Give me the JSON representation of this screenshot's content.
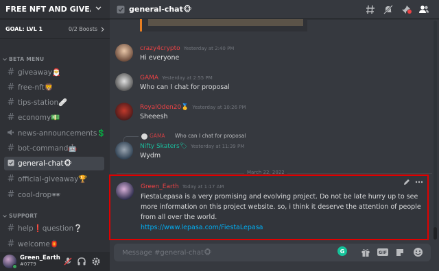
{
  "server": {
    "name": "FREE NFT AND GIVEAW..."
  },
  "boost": {
    "goal": "GOAL: LVL 1",
    "count": "0/2 Boosts"
  },
  "sidebar": {
    "category1": "BETA MENU",
    "category2": "SUPPORT",
    "channels": [
      {
        "label": "giveaway🎅"
      },
      {
        "label": "free-nft🦁"
      },
      {
        "label": "tips-station🩹"
      },
      {
        "label": "economy💵"
      },
      {
        "label": "news-announcements💲"
      },
      {
        "label": "bot-command🤖"
      },
      {
        "label": "general-chat🐵"
      },
      {
        "label": "official-giveaway🏆"
      },
      {
        "label": "cool-drop🕶"
      }
    ],
    "support_channels": [
      {
        "label": "help❗question❔"
      },
      {
        "label": "welcome🏮"
      }
    ]
  },
  "user": {
    "name": "Green_Earth",
    "tag": "#0779"
  },
  "topbar": {
    "title": "general-chat🐵"
  },
  "messages": [
    {
      "author": "crazy4crypto",
      "time": "Yesterday at 2:40 PM",
      "text": "Hi everyone",
      "color": "#ed4245"
    },
    {
      "author": "GAMA",
      "time": "Yesterday at 2:55 PM",
      "text": "Who can I chat for proposal",
      "color": "#ed4245"
    },
    {
      "author": "RoyalOden20🥇",
      "time": "Yesterday at 10:26 PM",
      "text": "Sheeesh",
      "color": "#ed4245"
    },
    {
      "author": "Nifty Skaters🏷",
      "time": "Yesterday at 11:39 PM",
      "text": "Wydm",
      "color": "#1abc9c"
    }
  ],
  "reply": {
    "author": "GAMA",
    "text": "Who can I chat for proposal"
  },
  "divider": {
    "label": "March 22, 2022"
  },
  "highlighted": {
    "author": "Green_Earth",
    "time": "Today at 1:17 AM",
    "line1": "FiestaLepasa is a very promising and evolving project. Do not be late hurry up to see",
    "line2": "more information on this project website. so, i think it deserve the attention of people",
    "line3": "from all over the world.",
    "link": "https://www.lepasa.com/FiestaLepasa",
    "color": "#ed4245"
  },
  "composer": {
    "placeholder": "Message #general-chat🐵",
    "gif": "GIF"
  },
  "grammarly": {
    "label": "G"
  },
  "colors": {
    "accent": "#e00000",
    "online": "#3ba55c",
    "link": "#00aff4"
  }
}
